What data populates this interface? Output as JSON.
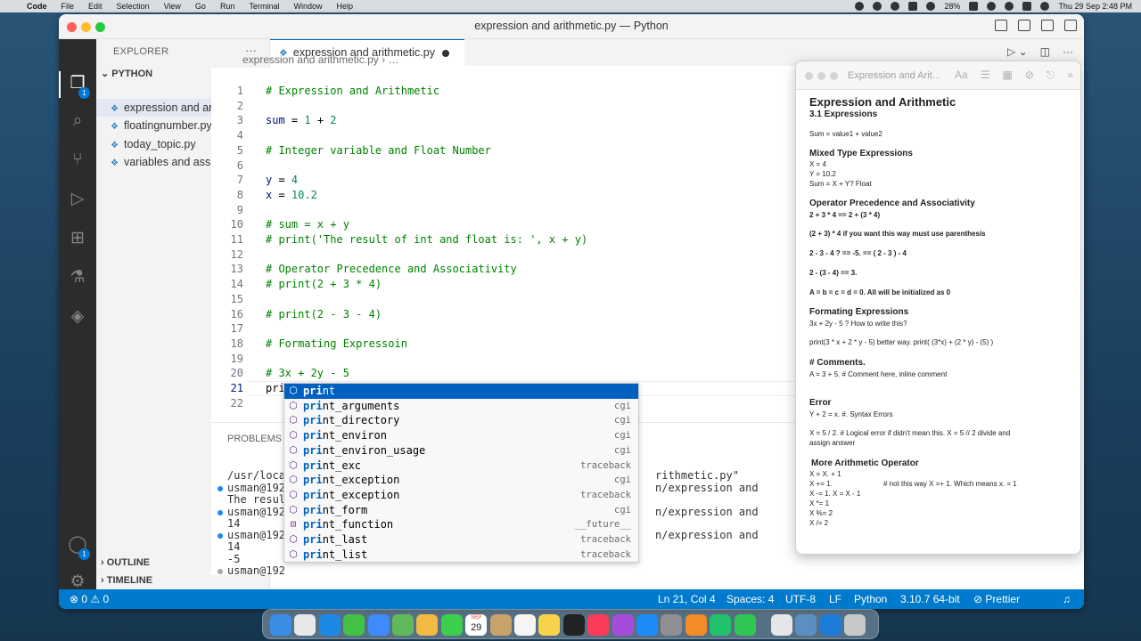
{
  "menubar": {
    "app_name": "Code",
    "items": [
      "File",
      "Edit",
      "Selection",
      "View",
      "Go",
      "Run",
      "Terminal",
      "Window",
      "Help"
    ],
    "battery": "28%",
    "clock": "Thu 29 Sep  2:48 PM"
  },
  "window": {
    "title": "expression and arithmetic.py — Python"
  },
  "activity": {
    "explorer_badge": "1",
    "accounts_badge": "1"
  },
  "sidebar": {
    "header": "EXPLORER",
    "more": "···",
    "section": "PYTHON",
    "files": [
      {
        "name": "expression and arithmetic.py"
      },
      {
        "name": "floatingnumber.py"
      },
      {
        "name": "today_topic.py"
      },
      {
        "name": "variables and assignment.py"
      }
    ],
    "outline": "OUTLINE",
    "timeline": "TIMELINE"
  },
  "tab": {
    "label": "expression and arithmetic.py"
  },
  "breadcrumb": {
    "file": "expression and arithmetic.py",
    "sep": " › …"
  },
  "editor": {
    "line_numbers": [
      "1",
      "2",
      "3",
      "4",
      "5",
      "6",
      "7",
      "8",
      "9",
      "10",
      "11",
      "12",
      "13",
      "14",
      "15",
      "16",
      "17",
      "18",
      "19",
      "20",
      "21",
      "22"
    ],
    "lines": [
      "# Expression and Arithmetic",
      "",
      "sum = 1 + 2",
      "",
      "# Integer variable and Float Number",
      "",
      "y = 4",
      "x = 10.2",
      "",
      "# sum = x + y",
      "# print('The result of int and float is: ', x + y)",
      "",
      "# Operator Precedence and Associativity",
      "# print(2 + 3 * 4)",
      "",
      "# print(2 - 3 - 4)",
      "",
      "# Formating Expressoin",
      "",
      "# 3x + 2y - 5",
      "pri",
      ""
    ]
  },
  "panel": {
    "tab": "PROBLEMS",
    "terminal_lines": [
      "/usr/local",
      "usman@192",
      "The result",
      "usman@192",
      "14",
      "usman@192",
      "14",
      "-5",
      "usman@192"
    ],
    "terminal_right": [
      "rithmetic.py\"",
      "n/expression and",
      "n/expression and",
      "n/expression and"
    ]
  },
  "suggest": {
    "items": [
      {
        "match": "pri",
        "rest": "nt",
        "detail": ""
      },
      {
        "match": "pri",
        "rest": "nt_arguments",
        "detail": "cgi"
      },
      {
        "match": "pri",
        "rest": "nt_directory",
        "detail": "cgi"
      },
      {
        "match": "pri",
        "rest": "nt_environ",
        "detail": "cgi"
      },
      {
        "match": "pri",
        "rest": "nt_environ_usage",
        "detail": "cgi"
      },
      {
        "match": "pri",
        "rest": "nt_exc",
        "detail": "traceback"
      },
      {
        "match": "pri",
        "rest": "nt_exception",
        "detail": "cgi"
      },
      {
        "match": "pri",
        "rest": "nt_exception",
        "detail": "traceback"
      },
      {
        "match": "pri",
        "rest": "nt_form",
        "detail": "cgi"
      },
      {
        "match": "pri",
        "rest": "nt_function",
        "detail": "__future__"
      },
      {
        "match": "pri",
        "rest": "nt_last",
        "detail": "traceback"
      },
      {
        "match": "pri",
        "rest": "nt_list",
        "detail": "traceback"
      }
    ]
  },
  "statusbar": {
    "problems": "⊗ 0 ⚠ 0",
    "position": "Ln 21, Col 4",
    "spaces": "Spaces: 4",
    "encoding": "UTF-8",
    "eol": "LF",
    "language": "Python",
    "interpreter": "3.10.7 64-bit",
    "prettier": "Prettier"
  },
  "notes": {
    "window_title": "Expression and Arit...",
    "lines": [
      {
        "text": "Expression and Arithmetic",
        "style": "h1"
      },
      {
        "text": "3.1 Expressions",
        "style": "h2"
      },
      {
        "text": "Sum = value1 + value2",
        "style": "p"
      },
      {
        "text": "Mixed Type Expressions",
        "style": "h3"
      },
      {
        "text": "X = 4",
        "style": "p"
      },
      {
        "text": "Y = 10.2",
        "style": "p"
      },
      {
        "text": "Sum = X + Y?      Float",
        "style": "p"
      },
      {
        "text": "Operator Precedence and Associativity",
        "style": "h3"
      },
      {
        "text": "2 + 3 * 4  == 2 + (3 * 4)",
        "style": "b"
      },
      {
        "text": "(2 + 3) * 4 if you want this way must use parenthesis",
        "style": "b"
      },
      {
        "text": "2 - 3 - 4 ? == -5.  == ( 2 - 3 ) - 4",
        "style": "b"
      },
      {
        "text": "2 - (3 - 4) == 3.",
        "style": "b"
      },
      {
        "text": "A = b = c = d = 0.  All will be initialized as 0",
        "style": "b"
      },
      {
        "text": "Formating Expressions",
        "style": "h3"
      },
      {
        "text": "3x + 2y - 5 ? How to write this?",
        "style": "p"
      },
      {
        "text": "print(3 * x + 2 * y - 5) better way. print( (3*x) + (2 * y) - (5) )",
        "style": "p"
      },
      {
        "text": "# Comments.",
        "style": "h3"
      },
      {
        "text": "A = 3 + 5.      # Comment here, inline comment",
        "style": "p"
      },
      {
        "text": "Error",
        "style": "h3"
      },
      {
        "text": "Y + 2 = x.        #. Syntax Errors",
        "style": "p"
      },
      {
        "text": "X = 5 / 2.        # Logical error if didn't mean this.  X = 5 // 2 divide  and",
        "style": "p"
      },
      {
        "text": "assign answer",
        "style": "p"
      },
      {
        "text": "More Arithmetic Operator",
        "style": "h3"
      },
      {
        "text": "X = X. + 1",
        "style": "p"
      },
      {
        "text": "X += 1.",
        "style": "p"
      },
      {
        "text": "X -= 1.  X = X - 1",
        "style": "p"
      },
      {
        "text": "X *= 1",
        "style": "p"
      },
      {
        "text": "X %= 2",
        "style": "p"
      },
      {
        "text": "X /= 2",
        "style": "p"
      },
      {
        "text": "# not this way X =+ 1.   Which means x. = 1",
        "style": "p"
      }
    ]
  },
  "dock": {
    "icons": [
      "finder-icon",
      "launchpad-icon",
      "safari-icon",
      "messages-icon",
      "mail-icon",
      "maps-icon",
      "photos-icon",
      "facetime-icon",
      "calendar-icon",
      "notes-app-icon",
      "reminders-icon",
      "notes-icon",
      "tv-icon",
      "music-icon",
      "podcasts-icon",
      "appstore-icon",
      "settings-icon",
      "blender-icon",
      "pycharm-icon",
      "whatsapp-icon",
      "preview-icon",
      "quicktime-icon",
      "vscode-icon",
      "trash-icon"
    ],
    "calendar_day": "29",
    "calendar_month": "SEP"
  }
}
